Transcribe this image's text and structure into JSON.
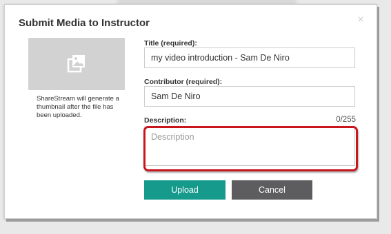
{
  "dialog": {
    "title": "Submit Media to Instructor",
    "close_symbol": "×"
  },
  "thumbnail": {
    "icon": "image-placeholder-icon",
    "note": "ShareStream will generate a thumbnail after the file has been uploaded."
  },
  "form": {
    "title_label": "Title (required):",
    "title_value": "my video introduction - Sam De Niro",
    "contributor_label": "Contributor (required):",
    "contributor_value": "Sam De Niro",
    "description_label": "Description:",
    "description_counter": "0/255",
    "description_placeholder": "Description",
    "description_value": ""
  },
  "buttons": {
    "upload": "Upload",
    "cancel": "Cancel"
  },
  "colors": {
    "upload_button": "#169a8c",
    "cancel_button": "#5d5d5f",
    "highlight": "#c9151c"
  }
}
